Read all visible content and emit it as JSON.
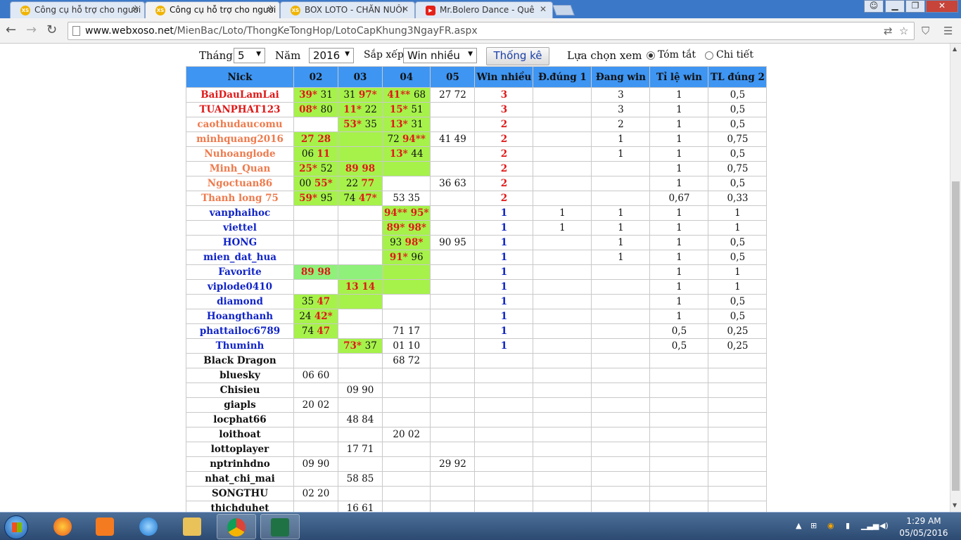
{
  "browser": {
    "tabs": [
      {
        "title": "Công cụ hỗ trợ cho người",
        "fav": "XS"
      },
      {
        "title": "Công cụ hỗ trợ cho người",
        "fav": "XS",
        "active": true
      },
      {
        "title": "BOX LOTO - CHĂN NUÔI",
        "fav": "XS"
      },
      {
        "title": "Mr.Bolero Dance - Quê",
        "fav": "yt"
      }
    ],
    "url_host": "www.webxoso.net",
    "url_path": "/MienBac/Loto/ThongKeTongHop/LotoCapKhung3NgayFR.aspx"
  },
  "controls": {
    "month_label": "Tháng",
    "month_value": "5",
    "year_label": "Năm",
    "year_value": "2016",
    "sort_label": "Sắp xếp",
    "sort_value": "Win nhiều",
    "stats_button": "Thống kê",
    "view_label": "Lựa chọn xem",
    "view_summary": "Tóm tắt",
    "view_detail": "Chi tiết",
    "view_selected": "summary"
  },
  "table": {
    "headers": [
      "Nick",
      "02",
      "03",
      "04",
      "05",
      "Win nhiều",
      "Đ.đúng 1",
      "Đang win",
      "Tỉ lệ win",
      "TL đúng 2"
    ],
    "colors": {
      "header_bg": "#3e95f2",
      "green": "#a6f24a",
      "light_green": "#8ff07a",
      "red": "#e01818",
      "orange": "#ef7a4c",
      "blue": "#1024c8"
    },
    "rows": [
      {
        "nick": "BaiDauLamLai",
        "c": "red",
        "d02": {
          "v": "39* 31",
          "h": "39*",
          "bg": "g"
        },
        "d03": {
          "v": "31 97*",
          "h": "97*",
          "bg": "g"
        },
        "d04": {
          "v": "41** 68",
          "h": "41**",
          "bg": "g"
        },
        "d05": {
          "v": "27 72"
        },
        "win": "3",
        "dd1": "",
        "dang": "3",
        "tl": "1",
        "tl2": "0,5"
      },
      {
        "nick": "TUANPHAT123",
        "c": "red",
        "d02": {
          "v": "08* 80",
          "h": "08*",
          "bg": "g"
        },
        "d03": {
          "v": "11* 22",
          "h": "11*",
          "bg": "g"
        },
        "d04": {
          "v": "15* 51",
          "h": "15*",
          "bg": "g"
        },
        "d05": {
          "v": ""
        },
        "win": "3",
        "dd1": "",
        "dang": "3",
        "tl": "1",
        "tl2": "0,5"
      },
      {
        "nick": "caothudaucomu",
        "c": "org",
        "d02": {
          "v": ""
        },
        "d03": {
          "v": "53* 35",
          "h": "53*",
          "bg": "g"
        },
        "d04": {
          "v": "13* 31",
          "h": "13*",
          "bg": "g"
        },
        "d05": {
          "v": ""
        },
        "win": "2",
        "dd1": "",
        "dang": "2",
        "tl": "1",
        "tl2": "0,5"
      },
      {
        "nick": "minhquang2016",
        "c": "org",
        "d02": {
          "v": "27 28",
          "h": "27 28",
          "bg": "g"
        },
        "d03": {
          "v": "",
          "bg": "g"
        },
        "d04": {
          "v": "72 94**",
          "h": "94**",
          "bg": "g"
        },
        "d05": {
          "v": "41 49"
        },
        "win": "2",
        "dd1": "",
        "dang": "1",
        "tl": "1",
        "tl2": "0,75"
      },
      {
        "nick": "Nuhoanglode",
        "c": "org",
        "d02": {
          "v": "06 11",
          "h": "11",
          "bg": "g"
        },
        "d03": {
          "v": "",
          "bg": "g"
        },
        "d04": {
          "v": "13* 44",
          "h": "13*",
          "bg": "g"
        },
        "d05": {
          "v": ""
        },
        "win": "2",
        "dd1": "",
        "dang": "1",
        "tl": "1",
        "tl2": "0,5"
      },
      {
        "nick": "Minh_Quan",
        "c": "org",
        "d02": {
          "v": "25* 52",
          "h": "25*",
          "bg": "g"
        },
        "d03": {
          "v": "89 98",
          "h": "89 98",
          "bg": "g"
        },
        "d04": {
          "v": "",
          "bg": "g"
        },
        "d05": {
          "v": ""
        },
        "win": "2",
        "dd1": "",
        "dang": "",
        "tl": "1",
        "tl2": "0,75"
      },
      {
        "nick": "Ngoctuan86",
        "c": "org",
        "d02": {
          "v": "00 55*",
          "h": "55*",
          "bg": "g"
        },
        "d03": {
          "v": "22 77",
          "h": "77",
          "bg": "g"
        },
        "d04": {
          "v": ""
        },
        "d05": {
          "v": "36 63"
        },
        "win": "2",
        "dd1": "",
        "dang": "",
        "tl": "1",
        "tl2": "0,5"
      },
      {
        "nick": "Thanh long 75",
        "c": "org",
        "d02": {
          "v": "59* 95",
          "h": "59*",
          "bg": "g"
        },
        "d03": {
          "v": "74 47*",
          "h": "47*",
          "bg": "g"
        },
        "d04": {
          "v": "53 35"
        },
        "d05": {
          "v": ""
        },
        "win": "2",
        "dd1": "",
        "dang": "",
        "tl": "0,67",
        "tl2": "0,33"
      },
      {
        "nick": "vanphaihoc",
        "c": "blu",
        "d02": {
          "v": ""
        },
        "d03": {
          "v": ""
        },
        "d04": {
          "v": "94** 95*",
          "h": "94** 95*",
          "bg": "g"
        },
        "d05": {
          "v": ""
        },
        "win": "1",
        "dd1": "1",
        "dang": "1",
        "tl": "1",
        "tl2": "1"
      },
      {
        "nick": "viettel",
        "c": "blu",
        "d02": {
          "v": ""
        },
        "d03": {
          "v": ""
        },
        "d04": {
          "v": "89* 98*",
          "h": "89* 98*",
          "bg": "g"
        },
        "d05": {
          "v": ""
        },
        "win": "1",
        "dd1": "1",
        "dang": "1",
        "tl": "1",
        "tl2": "1"
      },
      {
        "nick": "HONG",
        "c": "blu",
        "d02": {
          "v": ""
        },
        "d03": {
          "v": ""
        },
        "d04": {
          "v": "93 98*",
          "h": "98*",
          "bg": "g"
        },
        "d05": {
          "v": "90 95"
        },
        "win": "1",
        "dd1": "",
        "dang": "1",
        "tl": "1",
        "tl2": "0,5"
      },
      {
        "nick": "mien_dat_hua",
        "c": "blu",
        "d02": {
          "v": ""
        },
        "d03": {
          "v": ""
        },
        "d04": {
          "v": "91* 96",
          "h": "91*",
          "bg": "g"
        },
        "d05": {
          "v": ""
        },
        "win": "1",
        "dd1": "",
        "dang": "1",
        "tl": "1",
        "tl2": "0,5"
      },
      {
        "nick": "Favorite",
        "c": "blu",
        "d02": {
          "v": "89 98",
          "h": "89 98",
          "bg": "lg"
        },
        "d03": {
          "v": "",
          "bg": "lg"
        },
        "d04": {
          "v": "",
          "bg": "g"
        },
        "d05": {
          "v": ""
        },
        "win": "1",
        "dd1": "",
        "dang": "",
        "tl": "1",
        "tl2": "1"
      },
      {
        "nick": "viplode0410",
        "c": "blu",
        "d02": {
          "v": ""
        },
        "d03": {
          "v": "13 14",
          "h": "13 14",
          "bg": "g"
        },
        "d04": {
          "v": "",
          "bg": "g"
        },
        "d05": {
          "v": ""
        },
        "win": "1",
        "dd1": "",
        "dang": "",
        "tl": "1",
        "tl2": "1"
      },
      {
        "nick": "diamond",
        "c": "blu",
        "d02": {
          "v": "35 47",
          "h": "47",
          "bg": "g"
        },
        "d03": {
          "v": "",
          "bg": "g"
        },
        "d04": {
          "v": ""
        },
        "d05": {
          "v": ""
        },
        "win": "1",
        "dd1": "",
        "dang": "",
        "tl": "1",
        "tl2": "0,5"
      },
      {
        "nick": "Hoangthanh",
        "c": "blu",
        "d02": {
          "v": "24 42*",
          "h": "42*",
          "bg": "g"
        },
        "d03": {
          "v": ""
        },
        "d04": {
          "v": ""
        },
        "d05": {
          "v": ""
        },
        "win": "1",
        "dd1": "",
        "dang": "",
        "tl": "1",
        "tl2": "0,5"
      },
      {
        "nick": "phattailoc6789",
        "c": "blu",
        "d02": {
          "v": "74 47",
          "h": "47",
          "bg": "g"
        },
        "d03": {
          "v": ""
        },
        "d04": {
          "v": "71 17"
        },
        "d05": {
          "v": ""
        },
        "win": "1",
        "dd1": "",
        "dang": "",
        "tl": "0,5",
        "tl2": "0,25"
      },
      {
        "nick": "Thuminh",
        "c": "blu",
        "d02": {
          "v": ""
        },
        "d03": {
          "v": "73* 37",
          "h": "73*",
          "bg": "g"
        },
        "d04": {
          "v": "01 10"
        },
        "d05": {
          "v": ""
        },
        "win": "1",
        "dd1": "",
        "dang": "",
        "tl": "0,5",
        "tl2": "0,25"
      },
      {
        "nick": "Black Dragon",
        "c": "blk",
        "d02": {
          "v": ""
        },
        "d03": {
          "v": ""
        },
        "d04": {
          "v": "68 72"
        },
        "d05": {
          "v": ""
        },
        "win": "",
        "dd1": "",
        "dang": "",
        "tl": "",
        "tl2": ""
      },
      {
        "nick": "bluesky",
        "c": "blk",
        "d02": {
          "v": "06 60"
        },
        "d03": {
          "v": ""
        },
        "d04": {
          "v": ""
        },
        "d05": {
          "v": ""
        },
        "win": "",
        "dd1": "",
        "dang": "",
        "tl": "",
        "tl2": ""
      },
      {
        "nick": "Chisieu",
        "c": "blk",
        "d02": {
          "v": ""
        },
        "d03": {
          "v": "09 90"
        },
        "d04": {
          "v": ""
        },
        "d05": {
          "v": ""
        },
        "win": "",
        "dd1": "",
        "dang": "",
        "tl": "",
        "tl2": ""
      },
      {
        "nick": "giapls",
        "c": "blk",
        "d02": {
          "v": "20 02"
        },
        "d03": {
          "v": ""
        },
        "d04": {
          "v": ""
        },
        "d05": {
          "v": ""
        },
        "win": "",
        "dd1": "",
        "dang": "",
        "tl": "",
        "tl2": ""
      },
      {
        "nick": "locphat66",
        "c": "blk",
        "d02": {
          "v": ""
        },
        "d03": {
          "v": "48 84"
        },
        "d04": {
          "v": ""
        },
        "d05": {
          "v": ""
        },
        "win": "",
        "dd1": "",
        "dang": "",
        "tl": "",
        "tl2": ""
      },
      {
        "nick": "loithoat",
        "c": "blk",
        "d02": {
          "v": ""
        },
        "d03": {
          "v": ""
        },
        "d04": {
          "v": "20 02"
        },
        "d05": {
          "v": ""
        },
        "win": "",
        "dd1": "",
        "dang": "",
        "tl": "",
        "tl2": ""
      },
      {
        "nick": "lottoplayer",
        "c": "blk",
        "d02": {
          "v": ""
        },
        "d03": {
          "v": "17 71"
        },
        "d04": {
          "v": ""
        },
        "d05": {
          "v": ""
        },
        "win": "",
        "dd1": "",
        "dang": "",
        "tl": "",
        "tl2": ""
      },
      {
        "nick": "nptrinhdno",
        "c": "blk",
        "d02": {
          "v": "09 90"
        },
        "d03": {
          "v": ""
        },
        "d04": {
          "v": ""
        },
        "d05": {
          "v": "29 92"
        },
        "win": "",
        "dd1": "",
        "dang": "",
        "tl": "",
        "tl2": ""
      },
      {
        "nick": "nhat_chi_mai",
        "c": "blk",
        "d02": {
          "v": ""
        },
        "d03": {
          "v": "58 85"
        },
        "d04": {
          "v": ""
        },
        "d05": {
          "v": ""
        },
        "win": "",
        "dd1": "",
        "dang": "",
        "tl": "",
        "tl2": ""
      },
      {
        "nick": "SONGTHU",
        "c": "blk",
        "d02": {
          "v": "02 20"
        },
        "d03": {
          "v": ""
        },
        "d04": {
          "v": ""
        },
        "d05": {
          "v": ""
        },
        "win": "",
        "dd1": "",
        "dang": "",
        "tl": "",
        "tl2": ""
      },
      {
        "nick": "thichduhet",
        "c": "blk",
        "d02": {
          "v": ""
        },
        "d03": {
          "v": "16 61"
        },
        "d04": {
          "v": ""
        },
        "d05": {
          "v": ""
        },
        "win": "",
        "dd1": "",
        "dang": "",
        "tl": "",
        "tl2": ""
      }
    ]
  },
  "taskbar": {
    "apps": [
      "firefox-icon",
      "media-player-icon",
      "internet-explorer-icon",
      "file-explorer-icon",
      "chrome-icon",
      "excel-icon"
    ],
    "clock_time": "1:29 AM",
    "clock_date": "05/05/2016"
  }
}
